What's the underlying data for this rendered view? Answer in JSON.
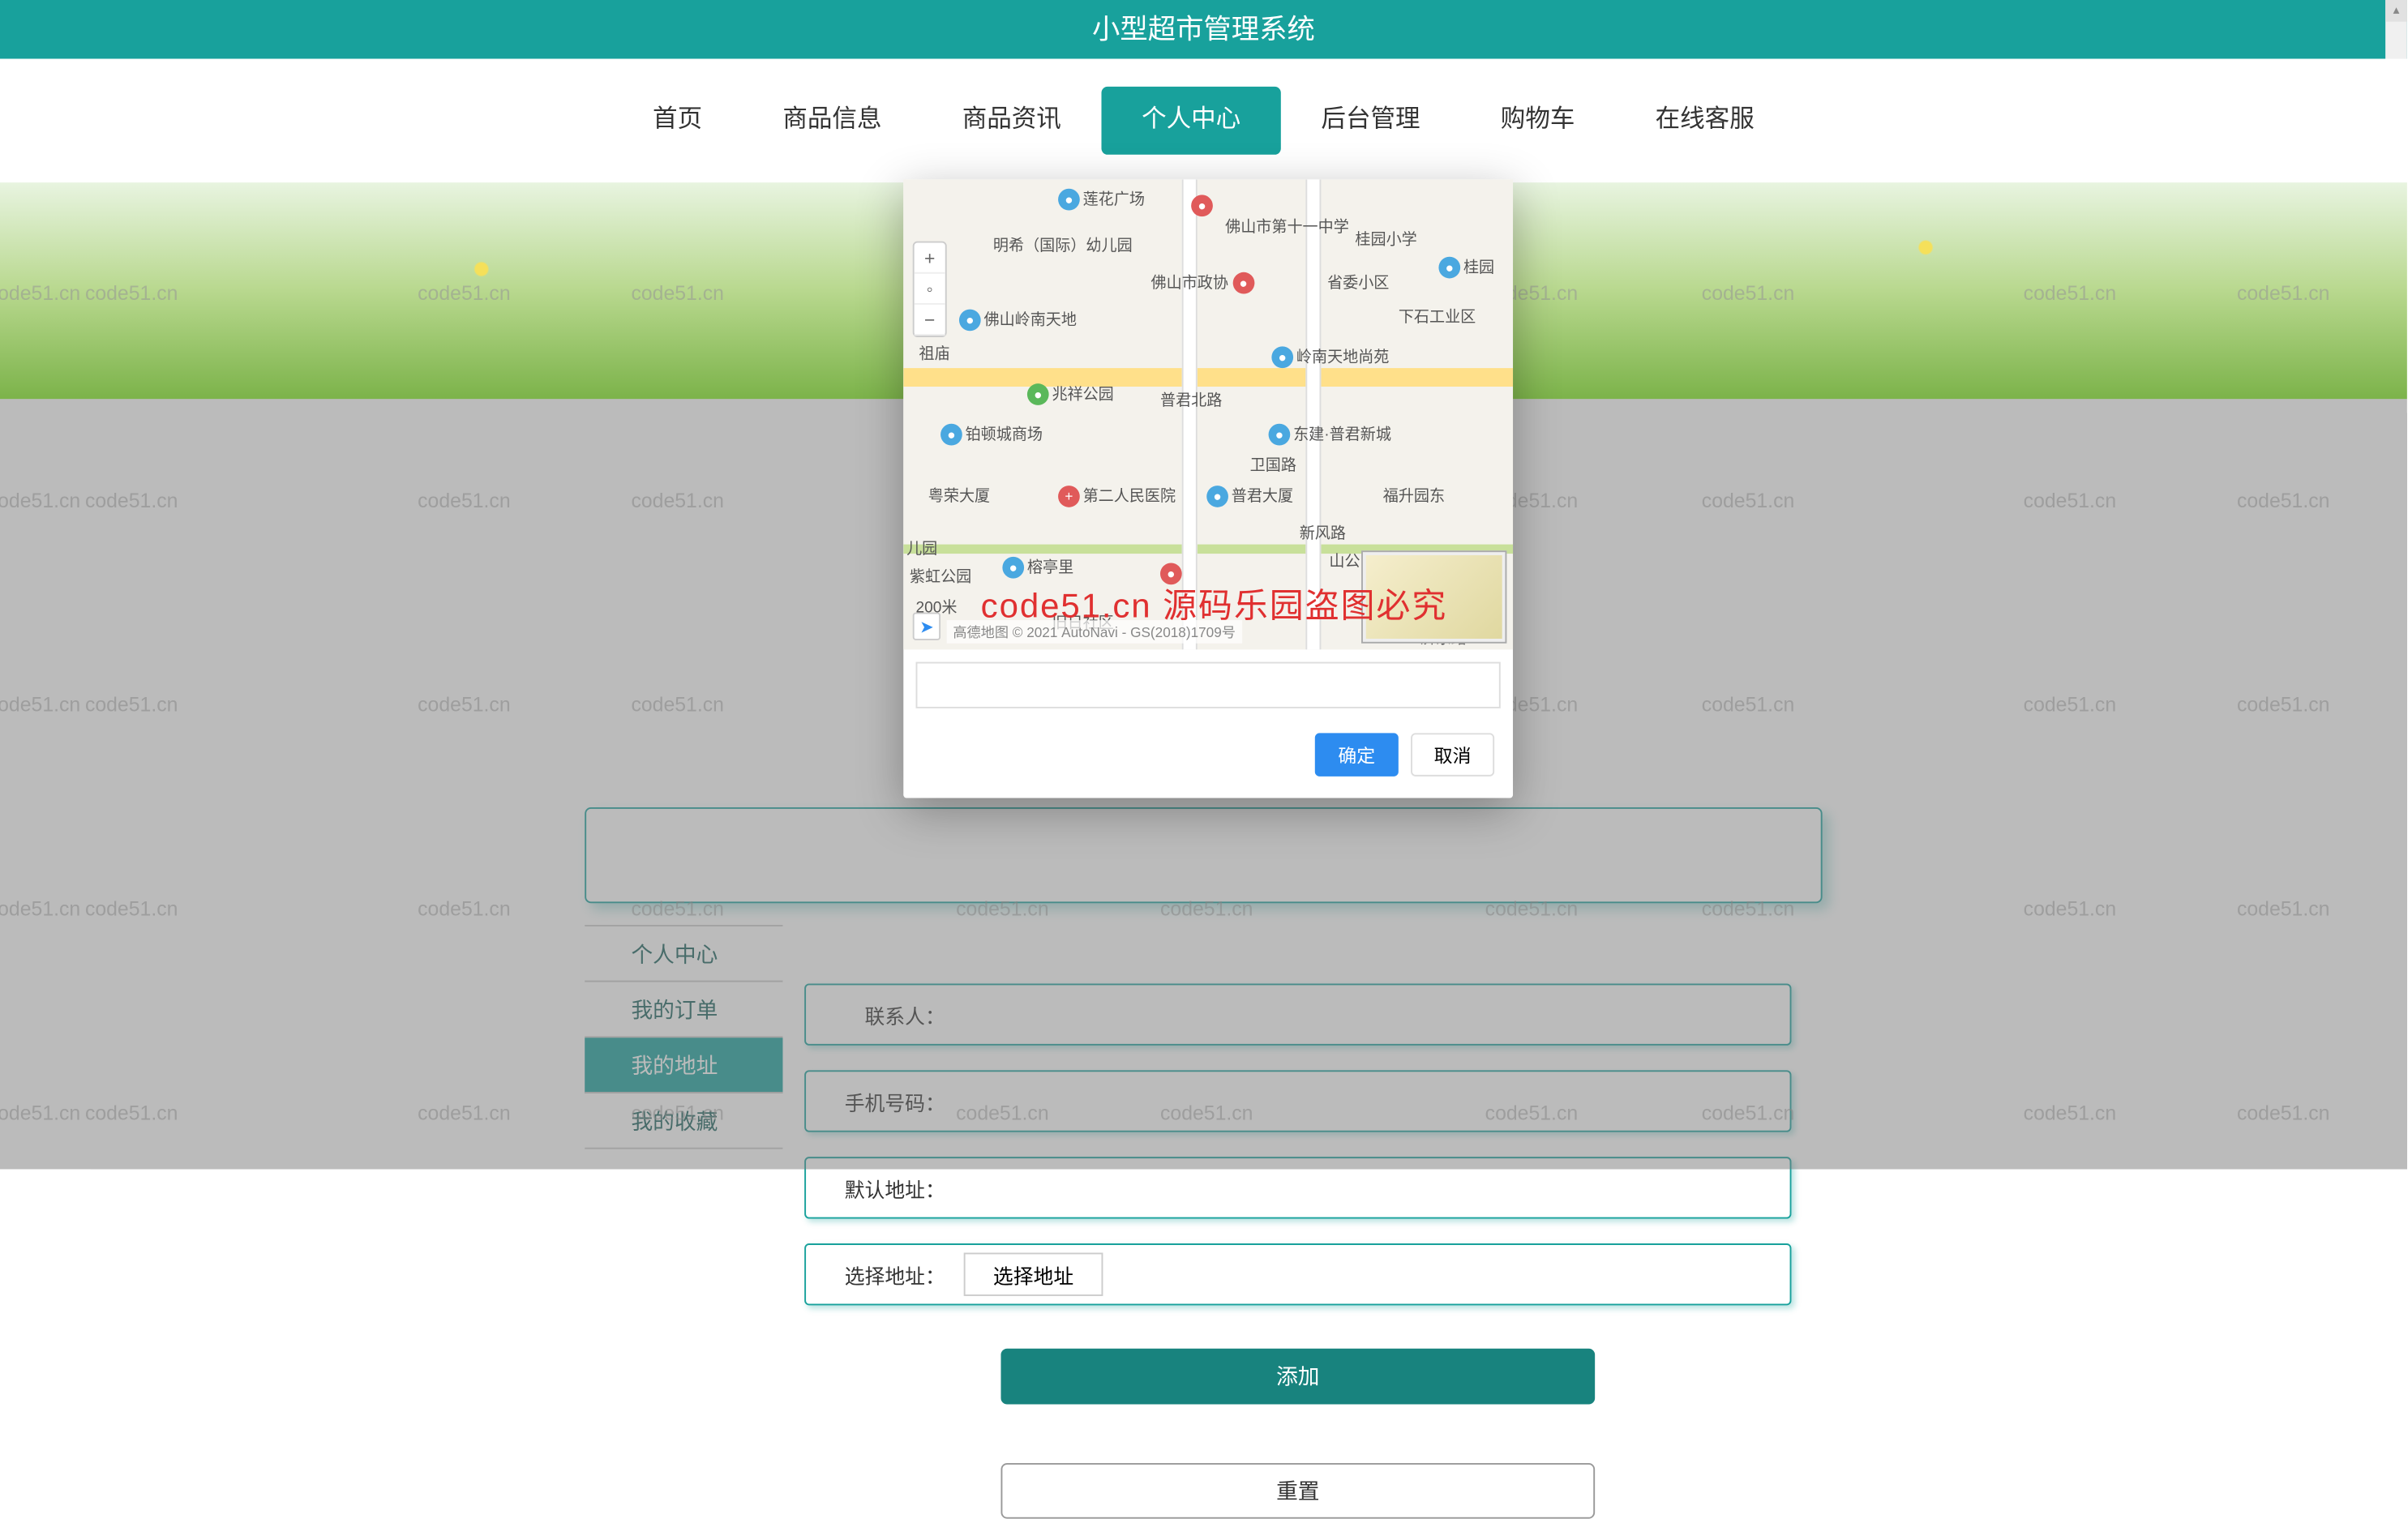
{
  "colors": {
    "primary": "#18a19c",
    "accent_blue": "#2d8cf0",
    "warn_red": "#e03030"
  },
  "header": {
    "title": "小型超市管理系统"
  },
  "watermark": "code51.cn",
  "red_watermark": "code51.cn 源码乐园盗图必究",
  "nav": {
    "items": [
      {
        "label": "首页",
        "active": false
      },
      {
        "label": "商品信息",
        "active": false
      },
      {
        "label": "商品资讯",
        "active": false
      },
      {
        "label": "个人中心",
        "active": true
      },
      {
        "label": "后台管理",
        "active": false
      },
      {
        "label": "购物车",
        "active": false
      },
      {
        "label": "在线客服",
        "active": false
      }
    ]
  },
  "sidebar": {
    "items": [
      {
        "label": "个人中心",
        "active": false
      },
      {
        "label": "我的订单",
        "active": false
      },
      {
        "label": "我的地址",
        "active": true
      },
      {
        "label": "我的收藏",
        "active": false
      }
    ]
  },
  "form": {
    "fields": {
      "contact": {
        "label": "联系人：",
        "value": ""
      },
      "phone": {
        "label": "手机号码：",
        "value": ""
      },
      "default": {
        "label": "默认地址：",
        "value": ""
      },
      "select_addr": {
        "label": "选择地址：",
        "placeholder": "选择地址"
      }
    },
    "buttons": {
      "add": "添加",
      "reset": "重置"
    }
  },
  "dialog": {
    "confirm": "确定",
    "cancel": "取消",
    "search_placeholder": "",
    "map": {
      "attribution": "高德地图 © 2021 AutoNavi - GS(2018)1709号",
      "places": [
        "莲花广场",
        "佛山市第十一中学",
        "桂园小学",
        "桂园",
        "明希（国际）幼儿园",
        "佛山市政协",
        "省委小区",
        "下石工业区",
        "佛山岭南天地",
        "祖庙",
        "岭南天地尚苑",
        "兆祥公园",
        "普君北路",
        "铂顿城商场",
        "东建·普君新城",
        "卫国路",
        "粤荣大厦",
        "第二人民医院",
        "普君大厦",
        "福升园东",
        "新风路",
        "200米",
        "榕亭里",
        "紫虹公园",
        "儿园",
        "山公园",
        "济东路",
        "旧日社区"
      ]
    }
  }
}
